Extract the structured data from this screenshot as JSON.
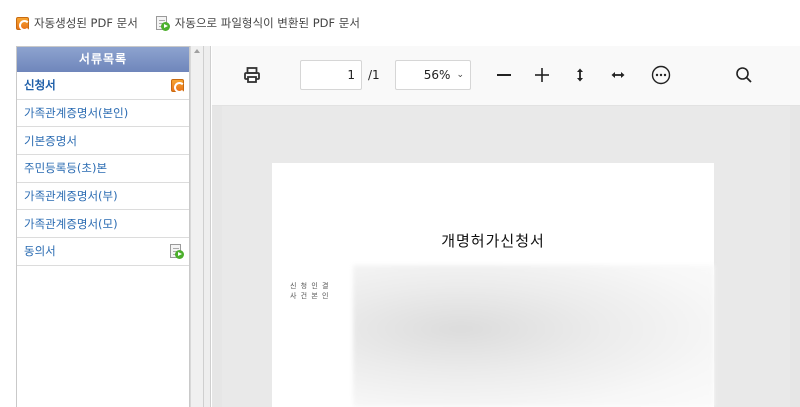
{
  "legend": {
    "auto_label": "자동생성된 PDF 문서",
    "converted_label": "자동으로 파일형식이 변환된 PDF 문서"
  },
  "sidebar": {
    "title": "서류목록",
    "items": [
      {
        "label": "신청서",
        "icon": "auto-generated-pdf-icon",
        "active": true
      },
      {
        "label": "가족관계증명서(본인)"
      },
      {
        "label": "기본증명서"
      },
      {
        "label": "주민등록등(초)본"
      },
      {
        "label": "가족관계증명서(부)"
      },
      {
        "label": "가족관계증명서(모)"
      },
      {
        "label": "동의서",
        "icon": "converted-pdf-icon"
      }
    ]
  },
  "viewer": {
    "page_current": "1",
    "page_total": "/1",
    "zoom": "56%",
    "icons": [
      "print-icon",
      "zoom-out-icon",
      "zoom-in-icon",
      "fit-height-icon",
      "fit-width-icon",
      "more-icon",
      "search-icon"
    ]
  },
  "document": {
    "title": "개명허가신청서",
    "side_text_1": "신 청 인 결",
    "side_text_2": "사 건 본 인"
  }
}
